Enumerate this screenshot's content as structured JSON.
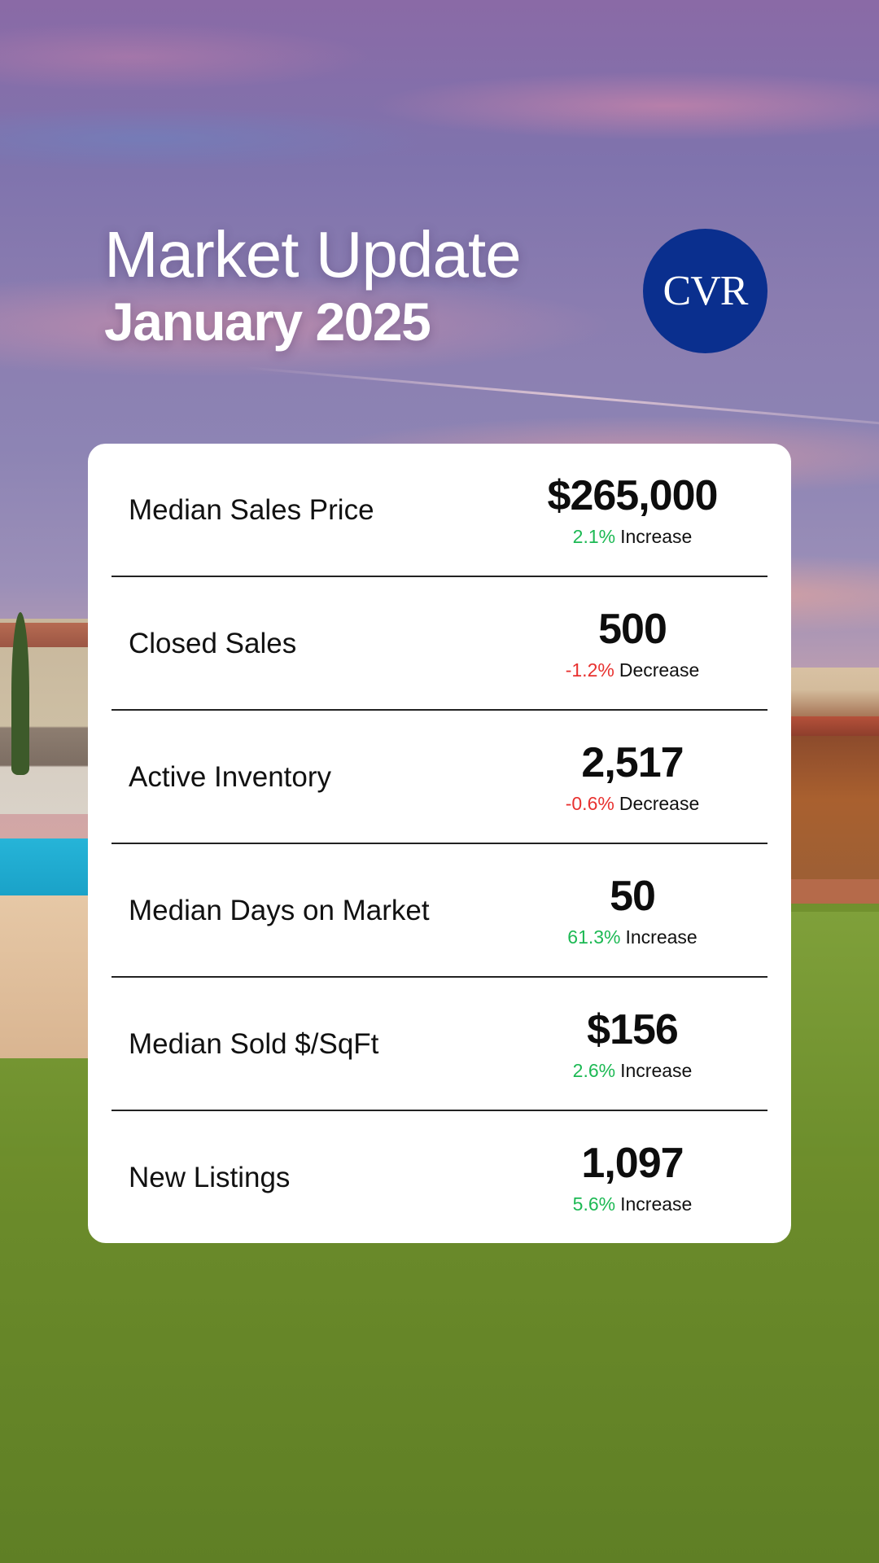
{
  "header": {
    "title_line1": "Market Update",
    "title_line2": "January 2025"
  },
  "logo": {
    "text": "CVR",
    "color": "#0a2f8e"
  },
  "colors": {
    "increase": "#1db954",
    "decrease": "#e8312f"
  },
  "stats": [
    {
      "label": "Median Sales Price",
      "value": "$265,000",
      "change": "2.1%",
      "direction": "Increase"
    },
    {
      "label": "Closed Sales",
      "value": "500",
      "change": "-1.2%",
      "direction": "Decrease"
    },
    {
      "label": "Active Inventory",
      "value": "2,517",
      "change": "-0.6%",
      "direction": "Decrease"
    },
    {
      "label": "Median Days on Market",
      "value": "50",
      "change": "61.3%",
      "direction": "Increase"
    },
    {
      "label": "Median Sold $/SqFt",
      "value": "$156",
      "change": "2.6%",
      "direction": "Increase"
    },
    {
      "label": "New Listings",
      "value": "1,097",
      "change": "5.6%",
      "direction": "Increase"
    }
  ]
}
